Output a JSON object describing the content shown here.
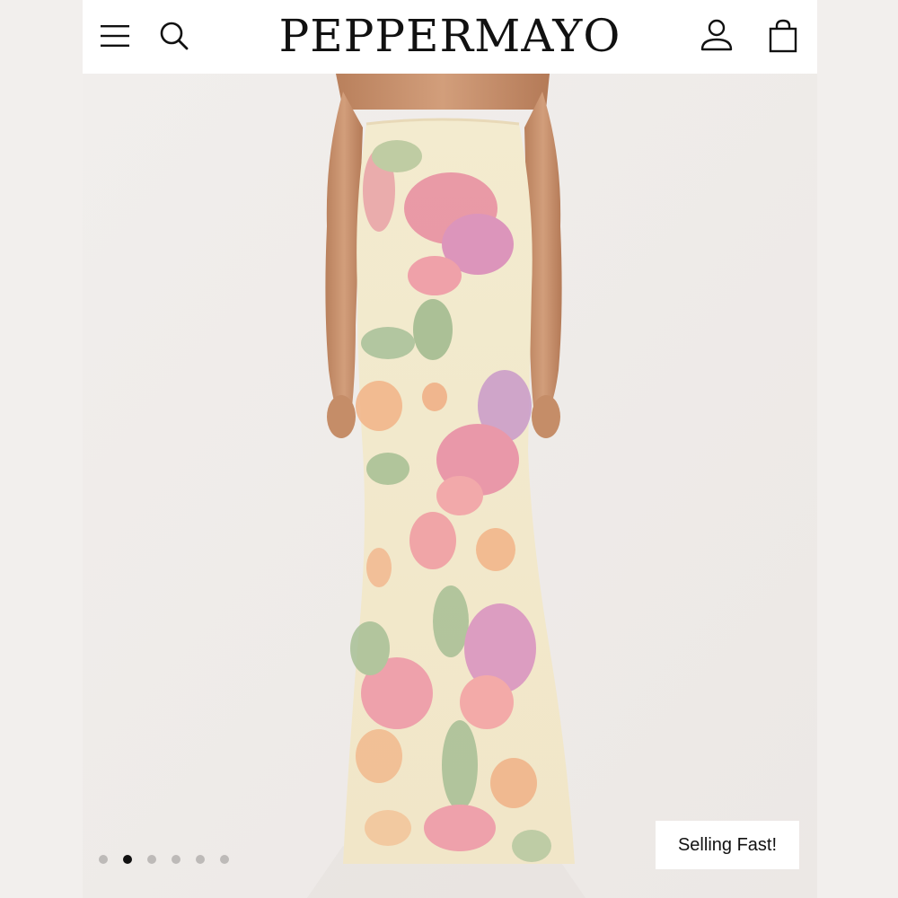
{
  "header": {
    "brand": "PEPPERMAYO",
    "icons": [
      "menu-icon",
      "search-icon",
      "account-icon",
      "bag-icon"
    ]
  },
  "product_gallery": {
    "image_alt": "Strapless floral maxi dress",
    "badge": "Selling Fast!",
    "slide_count": 6,
    "active_slide": 2
  },
  "colors": {
    "header_bg": "#ffffff",
    "page_bg": "#efebe8",
    "dot_active": "#111111",
    "dot_inactive": "#bdbab8"
  }
}
